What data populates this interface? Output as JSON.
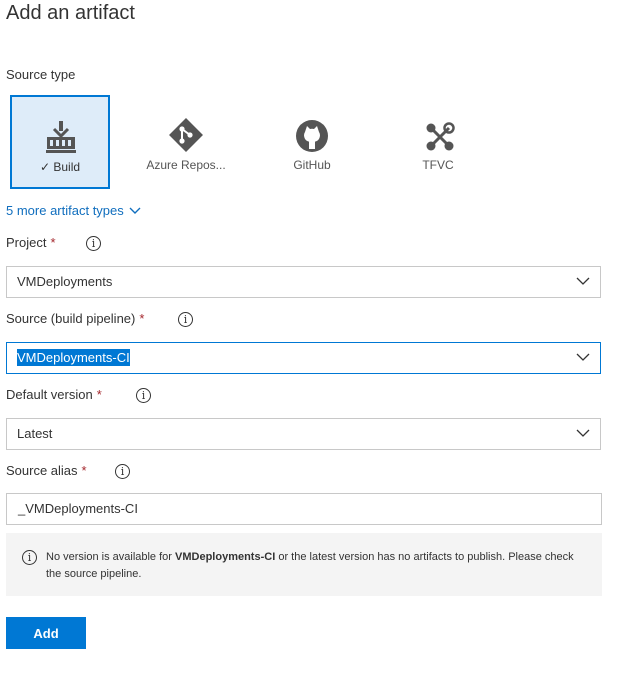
{
  "title": "Add an artifact",
  "source_type": {
    "label": "Source type",
    "tiles": [
      {
        "label": "Build",
        "check": "✓",
        "icon": "build-icon",
        "selected": true
      },
      {
        "label": "Azure Repos...",
        "icon": "azure-repos-icon",
        "selected": false
      },
      {
        "label": "GitHub",
        "icon": "github-icon",
        "selected": false
      },
      {
        "label": "TFVC",
        "icon": "tfvc-icon",
        "selected": false
      }
    ]
  },
  "more_types_link": "5 more artifact types",
  "fields": {
    "project": {
      "label": "Project",
      "required_mark": "*",
      "value": "VMDeployments"
    },
    "source": {
      "label": "Source (build pipeline)",
      "required_mark": "*",
      "value": "VMDeployments-CI"
    },
    "default_version": {
      "label": "Default version",
      "required_mark": "*",
      "value": "Latest"
    },
    "source_alias": {
      "label": "Source alias",
      "required_mark": "*",
      "value": "_VMDeployments-CI"
    }
  },
  "info_glyph": "i",
  "message": {
    "prefix": "No version is available for ",
    "bold": "VMDeployments-CI",
    "suffix": " or the latest version has no artifacts to publish. Please check the source pipeline."
  },
  "add_button": "Add",
  "colors": {
    "accent": "#0078d4",
    "link": "#106ebe",
    "required": "#a4262c",
    "selected_bg": "#deecf9"
  }
}
